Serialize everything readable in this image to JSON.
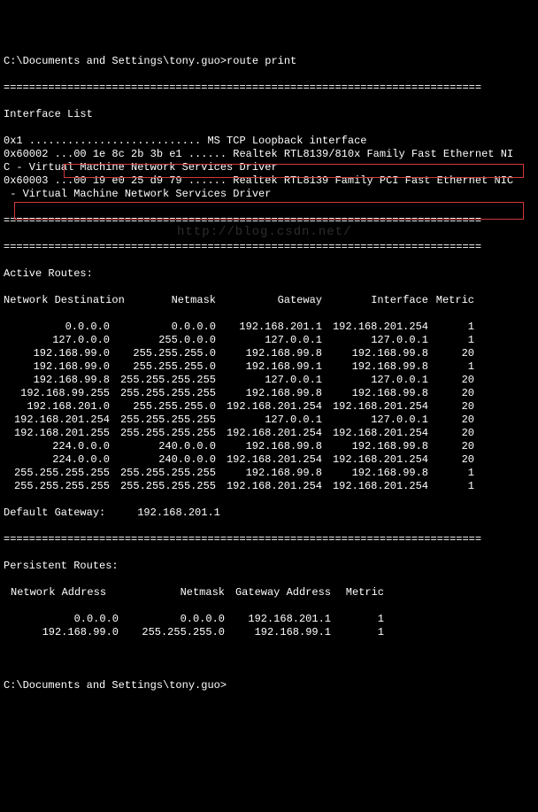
{
  "prompt_line": "C:\\Documents and Settings\\tony.guo>route print",
  "separator": "===========================================================================",
  "interface_list_header": "Interface List",
  "interfaces": [
    "0x1 ........................... MS TCP Loopback interface",
    "0x60002 ...00 1e 8c 2b 3b e1 ...... Realtek RTL8139/810x Family Fast Ethernet NI",
    "C - Virtual Machine Network Services Driver",
    "0x60003 ...00 19 e0 25 d9 79 ...... Realtek RTL8139 Family PCI Fast Ethernet NIC",
    " - Virtual Machine Network Services Driver"
  ],
  "active_routes_header": "Active Routes:",
  "headers": {
    "destination": "Network Destination",
    "netmask": "Netmask",
    "gateway": "Gateway",
    "interface": "Interface",
    "metric": "Metric"
  },
  "routes": [
    {
      "dest": "0.0.0.0",
      "mask": "0.0.0.0",
      "gw": "192.168.201.1",
      "if": "192.168.201.254",
      "metric": "1"
    },
    {
      "dest": "127.0.0.0",
      "mask": "255.0.0.0",
      "gw": "127.0.0.1",
      "if": "127.0.0.1",
      "metric": "1"
    },
    {
      "dest": "192.168.99.0",
      "mask": "255.255.255.0",
      "gw": "192.168.99.8",
      "if": "192.168.99.8",
      "metric": "20"
    },
    {
      "dest": "192.168.99.0",
      "mask": "255.255.255.0",
      "gw": "192.168.99.1",
      "if": "192.168.99.8",
      "metric": "1"
    },
    {
      "dest": "192.168.99.8",
      "mask": "255.255.255.255",
      "gw": "127.0.0.1",
      "if": "127.0.0.1",
      "metric": "20"
    },
    {
      "dest": "192.168.99.255",
      "mask": "255.255.255.255",
      "gw": "192.168.99.8",
      "if": "192.168.99.8",
      "metric": "20"
    },
    {
      "dest": "192.168.201.0",
      "mask": "255.255.255.0",
      "gw": "192.168.201.254",
      "if": "192.168.201.254",
      "metric": "20"
    },
    {
      "dest": "192.168.201.254",
      "mask": "255.255.255.255",
      "gw": "127.0.0.1",
      "if": "127.0.0.1",
      "metric": "20"
    },
    {
      "dest": "192.168.201.255",
      "mask": "255.255.255.255",
      "gw": "192.168.201.254",
      "if": "192.168.201.254",
      "metric": "20"
    },
    {
      "dest": "224.0.0.0",
      "mask": "240.0.0.0",
      "gw": "192.168.99.8",
      "if": "192.168.99.8",
      "metric": "20"
    },
    {
      "dest": "224.0.0.0",
      "mask": "240.0.0.0",
      "gw": "192.168.201.254",
      "if": "192.168.201.254",
      "metric": "20"
    },
    {
      "dest": "255.255.255.255",
      "mask": "255.255.255.255",
      "gw": "192.168.99.8",
      "if": "192.168.99.8",
      "metric": "1"
    },
    {
      "dest": "255.255.255.255",
      "mask": "255.255.255.255",
      "gw": "192.168.201.254",
      "if": "192.168.201.254",
      "metric": "1"
    }
  ],
  "default_gateway_label": "Default Gateway:",
  "default_gateway_value": "192.168.201.1",
  "persistent_routes_header": "Persistent Routes:",
  "p_headers": {
    "addr": "Network Address",
    "mask": "Netmask",
    "gw": "Gateway Address",
    "metric": "Metric"
  },
  "persistent_routes": [
    {
      "dest": "0.0.0.0",
      "mask": "0.0.0.0",
      "gw": "192.168.201.1",
      "metric": "1"
    },
    {
      "dest": "192.168.99.0",
      "mask": "255.255.255.0",
      "gw": "192.168.99.1",
      "metric": "1"
    }
  ],
  "prompt_end": "C:\\Documents and Settings\\tony.guo>",
  "watermark": "http://blog.csdn.net/",
  "highlight_rows": [
    0,
    3
  ]
}
